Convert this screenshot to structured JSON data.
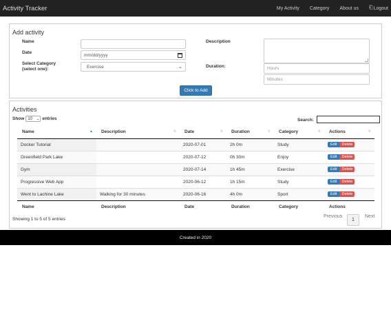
{
  "nav": {
    "brand": "Activity Tracker",
    "links": [
      "My Activity",
      "Category",
      "About us",
      "Logout"
    ]
  },
  "add": {
    "title": "Add activity",
    "name_label": "Name",
    "date_label": "Date",
    "date_placeholder": "mm/dd/yyyy",
    "category_label_1": "Select Category",
    "category_label_2": "(select one):",
    "category_value": "Exercise",
    "description_label": "Description",
    "duration_label": "Duration:",
    "hours_placeholder": "Hours",
    "minutes_placeholder": "Minutes",
    "submit_label": "Click to Add"
  },
  "activities": {
    "title": "Activities",
    "show_label": "Show",
    "length_value": "10",
    "entries_label": "entries",
    "search_label": "Search:",
    "columns": [
      "Name",
      "Description",
      "Date",
      "Duration",
      "Category",
      "Actions"
    ],
    "rows": [
      {
        "name": "Docker Tutorial",
        "description": "",
        "date": "2020-07-01",
        "duration": "2h 0m",
        "category": "Study"
      },
      {
        "name": "Greenfield Park Lake",
        "description": "",
        "date": "2020-07-12",
        "duration": "0h 30m",
        "category": "Enjoy"
      },
      {
        "name": "Gym",
        "description": "",
        "date": "2020-07-14",
        "duration": "1h 45m",
        "category": "Exercise"
      },
      {
        "name": "Progressive Web App",
        "description": "",
        "date": "2020-06-12",
        "duration": "1h 15m",
        "category": "Study"
      },
      {
        "name": "Went to Lachine Lake",
        "description": "Walking for 30 minutes",
        "date": "2020-06-16",
        "duration": "4h 0m",
        "category": "Sport"
      }
    ],
    "edit_label": "Edit",
    "delete_label": "Delete",
    "info": "Showing 1 to 5 of 5 entries",
    "prev_label": "Previous",
    "current_page": "1",
    "next_label": "Next"
  },
  "footer": {
    "text": "Created in 2020"
  }
}
